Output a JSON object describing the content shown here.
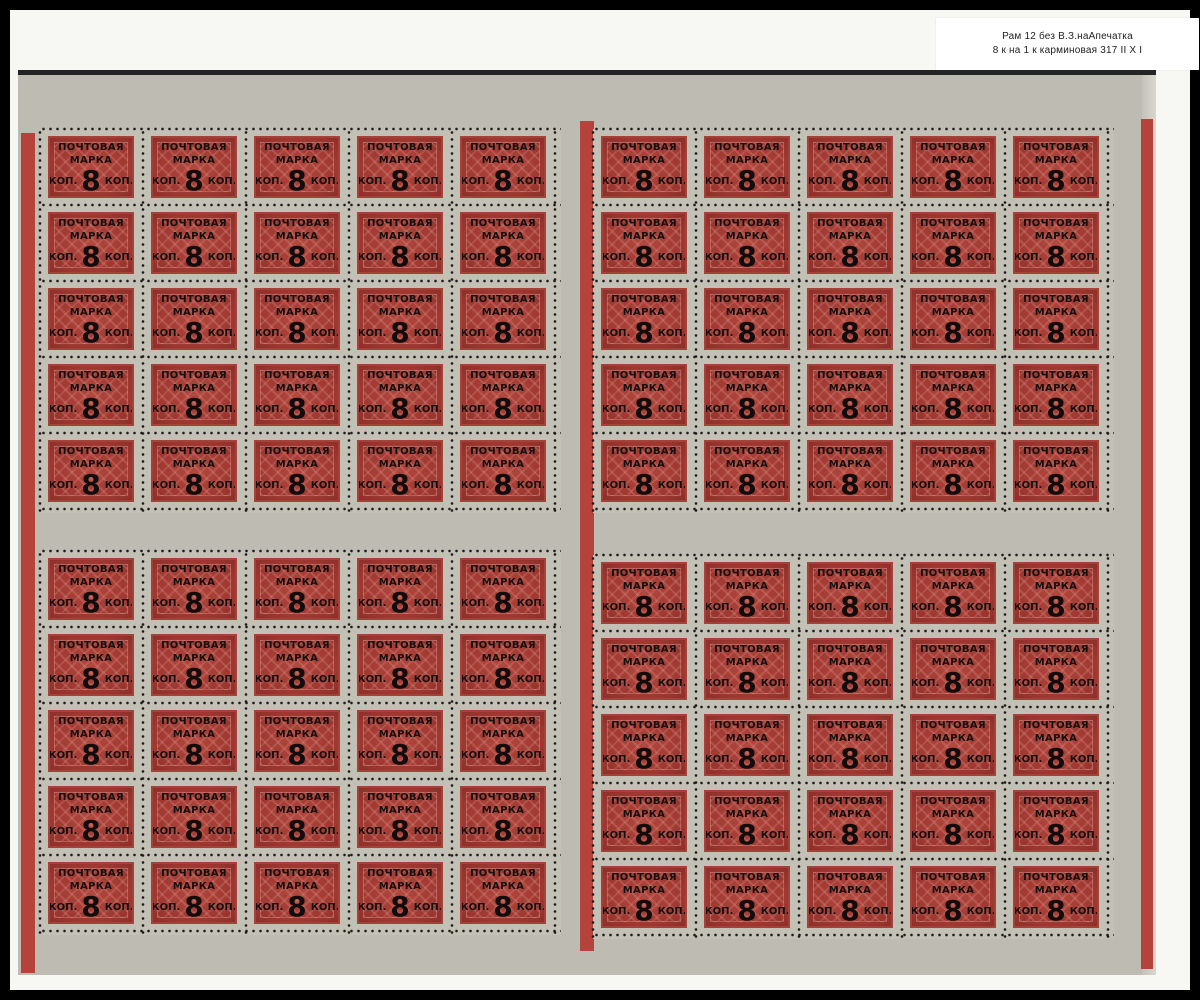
{
  "caption": {
    "line1": "Рам 12 без В.З.наАпечатка",
    "line2": "8 к на 1 к карминовая 317 II X I"
  },
  "stamp_overprint": {
    "line1": "ПОЧТОВАЯ",
    "line2": "МАРКА",
    "value_left": "КОП.",
    "value": "8",
    "value_right": "КОП."
  },
  "sheet": {
    "panes": 4,
    "rows_per_pane": 5,
    "cols_per_pane": 5,
    "stamp_color": "#a23c34",
    "margin_color": "#bdbbb2",
    "gutter_stripe_color": "#b5423b"
  }
}
